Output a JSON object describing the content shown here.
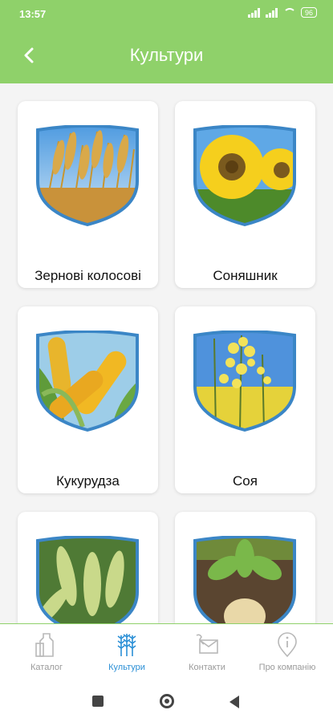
{
  "status_bar": {
    "time": "13:57",
    "battery": "96"
  },
  "app_bar": {
    "title": "Культури",
    "back_icon": "chevron-left-icon"
  },
  "crops": [
    {
      "label": "Зернові колосові",
      "image": "wheat-ears"
    },
    {
      "label": "Соняшник",
      "image": "sunflower"
    },
    {
      "label": "Кукурудза",
      "image": "corn-cobs"
    },
    {
      "label": "Соя",
      "image": "rapeseed-flowers"
    },
    {
      "label": "",
      "image": "soybean-pods"
    },
    {
      "label": "",
      "image": "sugar-beet"
    }
  ],
  "bottom_nav": [
    {
      "label": "Каталог",
      "icon": "catalog-bottle-icon",
      "active": false
    },
    {
      "label": "Культури",
      "icon": "wheat-icon",
      "active": true
    },
    {
      "label": "Контакти",
      "icon": "envelope-phone-icon",
      "active": false
    },
    {
      "label": "Про компанію",
      "icon": "info-pin-icon",
      "active": false
    }
  ],
  "colors": {
    "accent_green": "#8fd16a",
    "active_blue": "#2a8fd6",
    "shield_border": "#3b86c6"
  }
}
